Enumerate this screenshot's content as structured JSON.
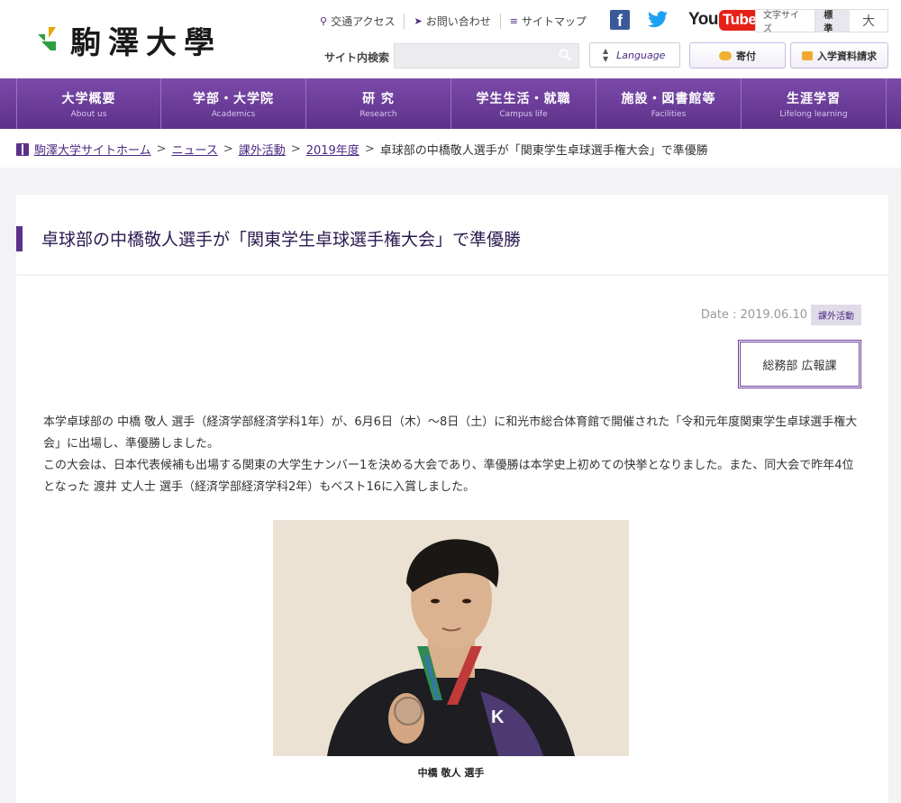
{
  "header": {
    "logo_text": "駒澤大學",
    "top_links": [
      {
        "icon": "pin-icon",
        "glyph": "⚲",
        "label": "交通アクセス"
      },
      {
        "icon": "send-icon",
        "glyph": "➤",
        "label": "お問い合わせ"
      },
      {
        "icon": "list-icon",
        "glyph": "≡",
        "label": "サイトマップ"
      }
    ],
    "social": {
      "facebook": "f",
      "youtube_you": "You",
      "youtube_tube": "Tube"
    },
    "font_size": {
      "label": "文字サイズ",
      "standard": "標準",
      "large": "大"
    },
    "search": {
      "label": "サイト内検索",
      "placeholder": ""
    },
    "language": "Language",
    "donate": "寄付",
    "request": "入学資料請求"
  },
  "gnav": [
    {
      "jp": "大学概要",
      "en": "About us"
    },
    {
      "jp": "学部・大学院",
      "en": "Academics"
    },
    {
      "jp": "研 究",
      "en": "Research"
    },
    {
      "jp": "学生生活・就職",
      "en": "Campus life"
    },
    {
      "jp": "施設・図書館等",
      "en": "Facilities"
    },
    {
      "jp": "生涯学習",
      "en": "Lifelong learning"
    }
  ],
  "breadcrumb": {
    "items": [
      "駒澤大学サイトホーム",
      "ニュース",
      "課外活動",
      "2019年度"
    ],
    "current": "卓球部の中橋敬人選手が「関東学生卓球選手権大会」で準優勝",
    "sep": ">"
  },
  "article": {
    "title": "卓球部の中橋敬人選手が「関東学生卓球選手権大会」で準優勝",
    "date": "Date : 2019.06.10",
    "tag": "課外活動",
    "department": "総務部 広報課",
    "paragraph1": "本学卓球部の 中橋 敬人 選手（経済学部経済学科1年）が、6月6日（木）～8日（土）に和光市総合体育館で開催された「令和元年度関東学生卓球選手権大会」に出場し、準優勝しました。",
    "paragraph2": "この大会は、日本代表候補も出場する関東の大学生ナンバー1を決める大会であり、準優勝は本学史上初めての快挙となりました。また、同大会で昨年4位となった 渡井 丈人士 選手（経済学部経済学科2年）もベスト16に入賞しました。",
    "photo_caption": "中橋 敬人 選手"
  },
  "colors": {
    "brand": "#5d3189",
    "tag_bg": "#e0dbe9"
  }
}
